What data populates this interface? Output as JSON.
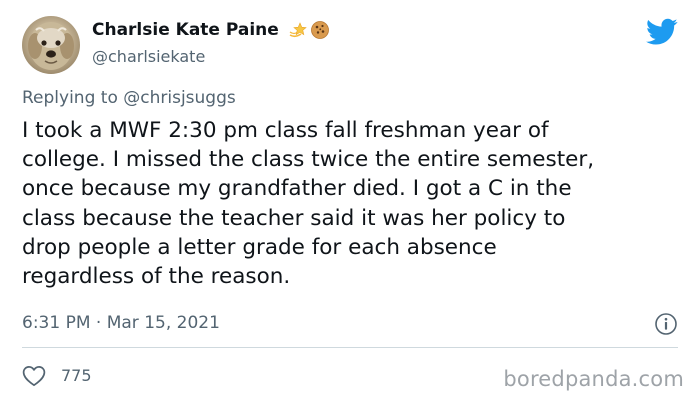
{
  "author": {
    "display_name": "Charlsie Kate Paine",
    "handle": "@charlsiekate",
    "name_emojis": [
      "dizzy-star-icon",
      "cookie-icon"
    ]
  },
  "reply": {
    "prefix": "Replying to ",
    "mention": "@chrisjsuggs"
  },
  "tweet": {
    "text": "I took a MWF 2:30 pm class fall freshman year of\ncollege. I missed the class twice the entire semester,\nonce because my grandfather died. I got a C in the\nclass because the teacher said it was her policy to\ndrop people a letter grade for each absence\nregardless of the reason.",
    "timestamp": "6:31 PM · Mar 15, 2021",
    "likes": "775"
  },
  "icons": {
    "brand": "twitter-bird-icon",
    "info": "info-icon",
    "like": "heart-icon"
  },
  "colors": {
    "twitter_blue": "#1d9bf0",
    "text_primary": "#0f1419",
    "text_secondary": "#536471",
    "divider": "#cfd9de",
    "watermark": "#9ea3a8"
  },
  "watermark": "boredpanda.com"
}
